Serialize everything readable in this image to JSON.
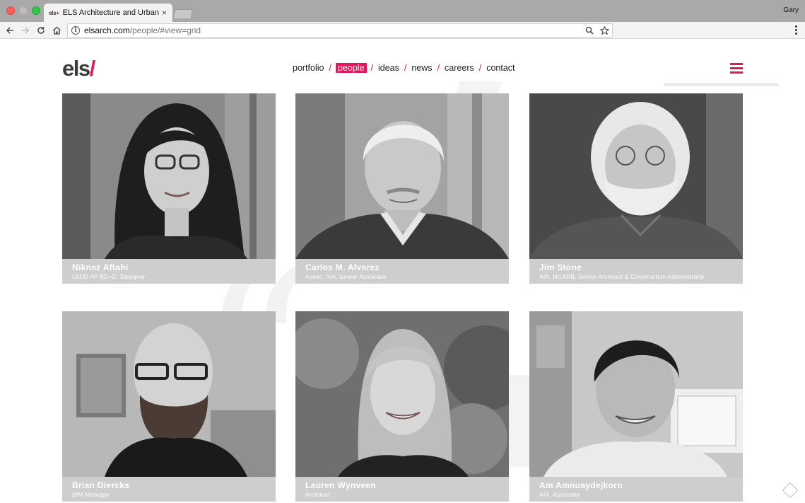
{
  "browser": {
    "tab_favicon_text": "els",
    "tab_title": "ELS Architecture and Urban De",
    "tab_close": "×",
    "profile_name": "Gary",
    "url_host": "elsarch.com",
    "url_path": "/people/#view=grid",
    "info_glyph": "i"
  },
  "site": {
    "logo_text": "els",
    "logo_slash": "/",
    "accent_color": "#e0185a"
  },
  "nav": {
    "items": [
      {
        "label": "portfolio",
        "active": false
      },
      {
        "label": "people",
        "active": true
      },
      {
        "label": "ideas",
        "active": false
      },
      {
        "label": "news",
        "active": false
      },
      {
        "label": "careers",
        "active": false
      },
      {
        "label": "contact",
        "active": false
      }
    ],
    "separator": "/"
  },
  "people": [
    {
      "name": "Niknaz Aftahi",
      "title": "LEED AP BD+C, Designer"
    },
    {
      "name": "Carlos M. Alvarez",
      "title": "Assoc. AIA, Senior Associate"
    },
    {
      "name": "Jim Stone",
      "title": "AIA, NCARB, Senior Architect & Construction Administrator"
    },
    {
      "name": "Brian Diercks",
      "title": "BIM Manager"
    },
    {
      "name": "Lauren Wynveen",
      "title": "Architect"
    },
    {
      "name": "Am Amnuaydejkorn",
      "title": "AIA, Associate"
    }
  ]
}
